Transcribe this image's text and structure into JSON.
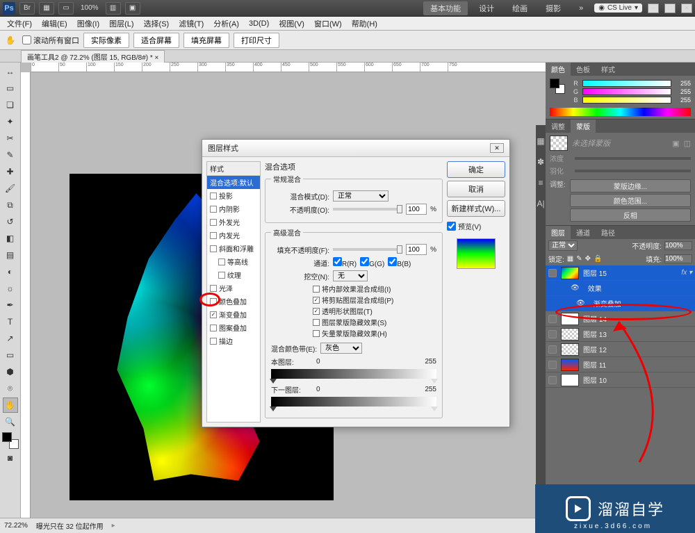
{
  "topbar": {
    "logo": "Ps",
    "zoom": "100%",
    "workspace_active": "基本功能",
    "workspaces": [
      "设计",
      "绘画",
      "摄影"
    ],
    "cslive": "CS Live"
  },
  "menu": [
    "文件(F)",
    "编辑(E)",
    "图像(I)",
    "图层(L)",
    "选择(S)",
    "滤镜(T)",
    "分析(A)",
    "3D(D)",
    "视图(V)",
    "窗口(W)",
    "帮助(H)"
  ],
  "optbar": {
    "scroll_all": "滚动所有窗口",
    "btns": [
      "实际像素",
      "适合屏幕",
      "填充屏幕",
      "打印尺寸"
    ]
  },
  "doc_tab": "画笔工具2 @ 72.2% (图层 15, RGB/8#) *",
  "ruler_ticks": [
    "0",
    "50",
    "100",
    "150",
    "200",
    "250",
    "300",
    "350",
    "400",
    "450",
    "500",
    "550",
    "600",
    "650",
    "700",
    "750"
  ],
  "color": {
    "tabs": [
      "颜色",
      "色板",
      "样式"
    ],
    "r": "255",
    "g": "255",
    "b": "255"
  },
  "mask": {
    "tabs": [
      "调整",
      "蒙版"
    ],
    "none": "未选择蒙版",
    "density": "浓度",
    "feather": "羽化",
    "refine": "调整:",
    "btns": [
      "蒙版边缘...",
      "颜色范围...",
      "反相"
    ]
  },
  "layers": {
    "tabs": [
      "图层",
      "通道",
      "路径"
    ],
    "mode": "正常",
    "opacity_l": "不透明度:",
    "opacity_v": "100%",
    "lock": "锁定:",
    "fill_l": "填充:",
    "fill_v": "100%",
    "rows": [
      {
        "name": "图层 15",
        "thumb": "grad",
        "sel": true,
        "fx": true
      },
      {
        "name": "效果",
        "indent": true,
        "icon": "eye"
      },
      {
        "name": "渐变叠加",
        "indent": true,
        "icon": "dot"
      },
      {
        "name": "图层 14",
        "thumb": "white"
      },
      {
        "name": "图层 13",
        "thumb": "chk"
      },
      {
        "name": "图层 12",
        "thumb": "chk"
      },
      {
        "name": "图层 11",
        "thumb": "gradmini"
      },
      {
        "name": "图层 10",
        "thumb": "white"
      }
    ]
  },
  "dialog": {
    "title": "图层样式",
    "styles_header": "样式",
    "styles": [
      {
        "label": "混合选项:默认",
        "sel": true
      },
      {
        "label": "投影",
        "ck": false
      },
      {
        "label": "内阴影",
        "ck": false
      },
      {
        "label": "外发光",
        "ck": false
      },
      {
        "label": "内发光",
        "ck": false
      },
      {
        "label": "斜面和浮雕",
        "ck": false
      },
      {
        "label": "等高线",
        "indent": true,
        "ck": false
      },
      {
        "label": "纹理",
        "indent": true,
        "ck": false
      },
      {
        "label": "光泽",
        "ck": false
      },
      {
        "label": "颜色叠加",
        "ck": false
      },
      {
        "label": "渐变叠加",
        "ck": true,
        "highlight": true
      },
      {
        "label": "图案叠加",
        "ck": false
      },
      {
        "label": "描边",
        "ck": false
      }
    ],
    "section_blend": "混合选项",
    "general": "常规混合",
    "blendmode_l": "混合模式(D):",
    "blendmode_v": "正常",
    "opacity_l": "不透明度(O):",
    "opacity_v": "100",
    "pct": "%",
    "advanced": "高级混合",
    "fillop_l": "填充不透明度(F):",
    "fillop_v": "100",
    "channels_l": "通道:",
    "chR": "R(R)",
    "chG": "G(G)",
    "chB": "B(B)",
    "knockout_l": "挖空(N):",
    "knockout_v": "无",
    "cks": [
      "将内部效果混合成组(I)",
      "将剪贴图层混合成组(P)",
      "透明形状图层(T)",
      "图层蒙版隐藏效果(S)",
      "矢量蒙版隐藏效果(H)"
    ],
    "ck_states": [
      false,
      true,
      true,
      false,
      false
    ],
    "blendif_l": "混合颜色带(E):",
    "blendif_v": "灰色",
    "this_l": "本图层:",
    "this_a": "0",
    "this_b": "255",
    "under_l": "下一图层:",
    "under_a": "0",
    "under_b": "255",
    "btns": {
      "ok": "确定",
      "cancel": "取消",
      "new": "新建样式(W)...",
      "preview": "预览(V)"
    }
  },
  "status": {
    "zoom": "72.22%",
    "info": "曝光只在 32 位起作用"
  },
  "watermark": {
    "brand": "溜溜自学",
    "url": "zixue.3d66.com"
  }
}
